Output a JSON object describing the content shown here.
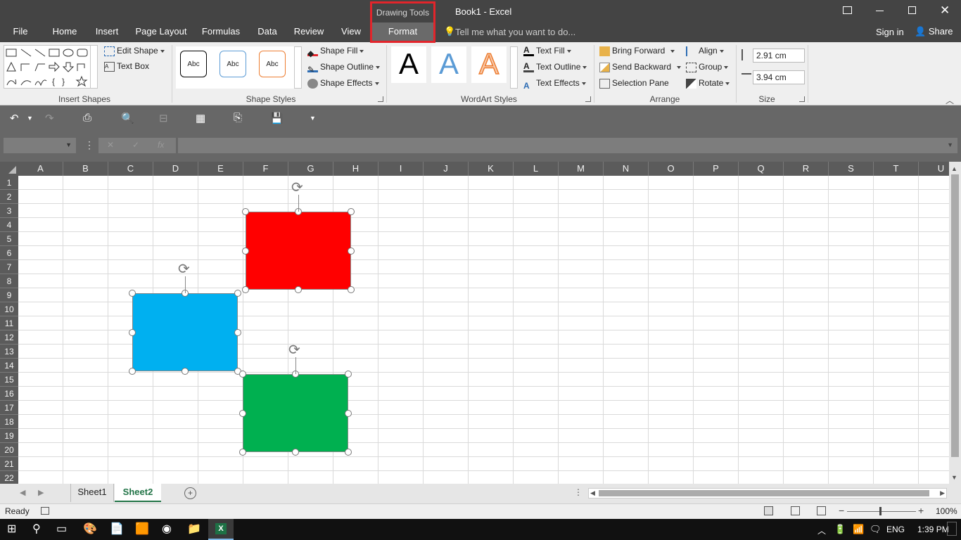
{
  "window": {
    "title": "Book1 - Excel"
  },
  "context_tab": {
    "group": "Drawing Tools",
    "tab": "Format"
  },
  "tabs": {
    "file": "File",
    "home": "Home",
    "insert": "Insert",
    "page_layout": "Page Layout",
    "formulas": "Formulas",
    "data": "Data",
    "review": "Review",
    "view": "View"
  },
  "tell_me": "Tell me what you want to do...",
  "sign_in": "Sign in",
  "share": "Share",
  "ribbon": {
    "insert_shapes": {
      "label": "Insert Shapes",
      "edit_shape": "Edit Shape",
      "text_box": "Text Box"
    },
    "shape_styles": {
      "label": "Shape Styles",
      "sample": "Abc",
      "shape_fill": "Shape Fill",
      "shape_outline": "Shape Outline",
      "shape_effects": "Shape Effects"
    },
    "wordart": {
      "label": "WordArt Styles",
      "sample": "A",
      "text_fill": "Text Fill",
      "text_outline": "Text Outline",
      "text_effects": "Text Effects"
    },
    "arrange": {
      "label": "Arrange",
      "bring_forward": "Bring Forward",
      "send_backward": "Send Backward",
      "selection_pane": "Selection Pane",
      "align": "Align",
      "group": "Group",
      "rotate": "Rotate"
    },
    "size": {
      "label": "Size",
      "height": "2.91 cm",
      "width": "3.94 cm"
    }
  },
  "formula_bar": {
    "fx": "fx",
    "name_box": "",
    "content": ""
  },
  "columns": [
    "A",
    "B",
    "C",
    "D",
    "E",
    "F",
    "G",
    "H",
    "I",
    "J",
    "K",
    "L",
    "M",
    "N",
    "O",
    "P",
    "Q",
    "R",
    "S",
    "T",
    "U"
  ],
  "rows": [
    "1",
    "2",
    "3",
    "4",
    "5",
    "6",
    "7",
    "8",
    "9",
    "10",
    "11",
    "12",
    "13",
    "14",
    "15",
    "16",
    "17",
    "18",
    "19",
    "20",
    "21",
    "22"
  ],
  "shapes": [
    {
      "name": "red-rectangle",
      "color": "#ff0000"
    },
    {
      "name": "blue-rectangle",
      "color": "#00b0f0"
    },
    {
      "name": "green-rectangle",
      "color": "#00b050"
    }
  ],
  "sheets": [
    "Sheet1",
    "Sheet2"
  ],
  "active_sheet": "Sheet2",
  "status": {
    "ready": "Ready",
    "zoom": "100%"
  },
  "taskbar": {
    "lang": "ENG",
    "time": "1:39 PM"
  }
}
